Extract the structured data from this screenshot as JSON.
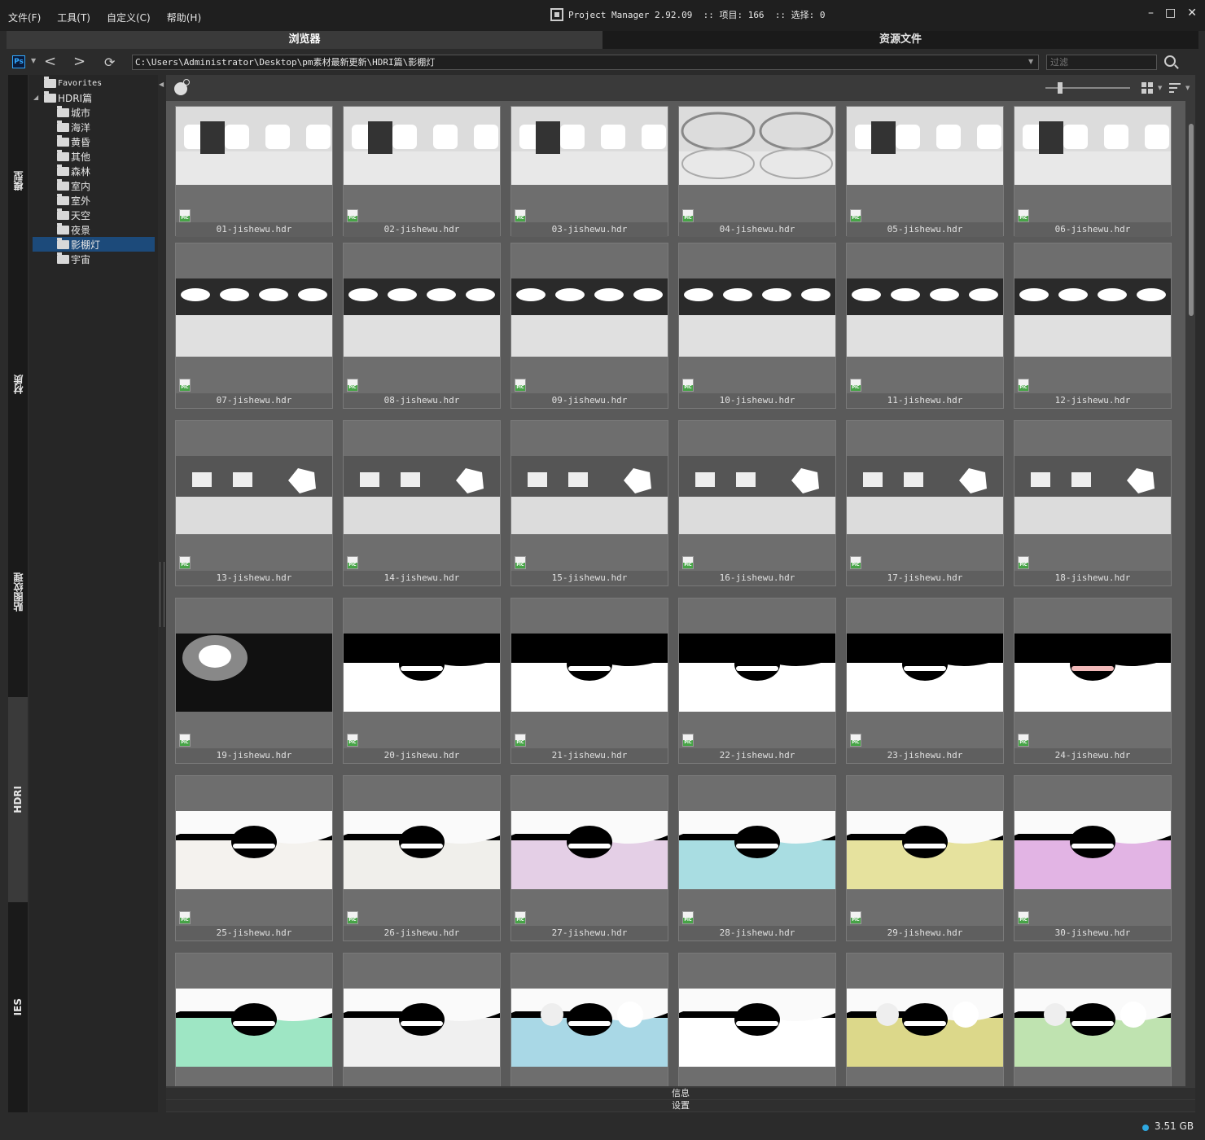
{
  "menu": [
    "文件(F)",
    "工具(T)",
    "自定义(C)",
    "帮助(H)"
  ],
  "title": {
    "app": "Project Manager 2.92.09",
    "items": ":: 项目: 166",
    "selection": ":: 选择: 0"
  },
  "window_controls": [
    "–",
    "□",
    "✕"
  ],
  "tabs": {
    "browser": "浏览器",
    "assets": "资源文件"
  },
  "address": {
    "ps_label": "Ps",
    "path": "C:\\Users\\Administrator\\Desktop\\pm素材最新更新\\HDRI篇\\影棚灯",
    "filter_placeholder": "过滤"
  },
  "vertical_tabs": [
    "模型",
    "材质",
    "贴图纹理",
    "HDRI",
    "IES"
  ],
  "tree": {
    "favorites": "Favorites",
    "root": "HDRI篇",
    "children": [
      "城市",
      "海洋",
      "黄昏",
      "其他",
      "森林",
      "室内",
      "室外",
      "天空",
      "夜景",
      "影棚灯",
      "宇宙"
    ],
    "selected": "影棚灯"
  },
  "files": [
    "01-jishewu.hdr",
    "02-jishewu.hdr",
    "03-jishewu.hdr",
    "04-jishewu.hdr",
    "05-jishewu.hdr",
    "06-jishewu.hdr",
    "07-jishewu.hdr",
    "08-jishewu.hdr",
    "09-jishewu.hdr",
    "10-jishewu.hdr",
    "11-jishewu.hdr",
    "12-jishewu.hdr",
    "13-jishewu.hdr",
    "14-jishewu.hdr",
    "15-jishewu.hdr",
    "16-jishewu.hdr",
    "17-jishewu.hdr",
    "18-jishewu.hdr",
    "19-jishewu.hdr",
    "20-jishewu.hdr",
    "21-jishewu.hdr",
    "22-jishewu.hdr",
    "23-jishewu.hdr",
    "24-jishewu.hdr",
    "25-jishewu.hdr",
    "26-jishewu.hdr",
    "27-jishewu.hdr",
    "28-jishewu.hdr",
    "29-jishewu.hdr",
    "30-jishewu.hdr"
  ],
  "bottom": {
    "info": "信息",
    "settings": "设置"
  },
  "status": {
    "disk": "3.51 GB"
  },
  "colors": {
    "accent": "#2ea8e0",
    "selection": "#1c4a7a",
    "tile": "#6e6e6e"
  }
}
